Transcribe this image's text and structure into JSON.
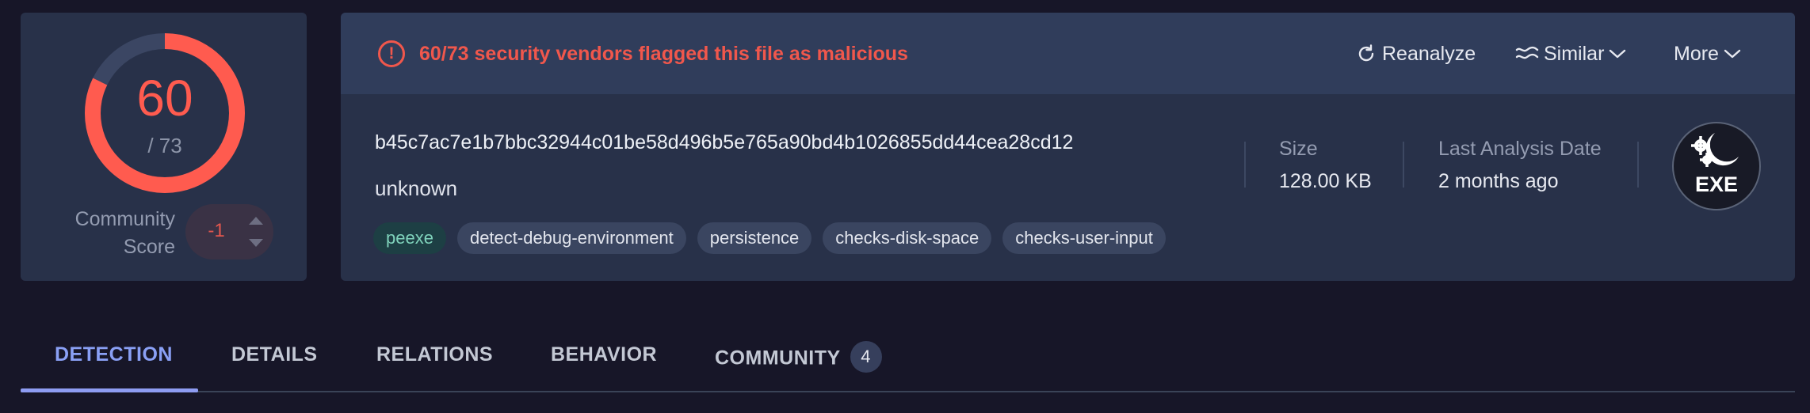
{
  "score": {
    "detections": "60",
    "total": "/ 73",
    "detection_ratio": 0.822,
    "community_label_line1": "Community",
    "community_label_line2": "Score",
    "community_value": "-1"
  },
  "alert": {
    "text": "60/73 security vendors flagged this file as malicious",
    "icon": "exclamation-circle-icon"
  },
  "actions": {
    "reanalyze": "Reanalyze",
    "similar": "Similar",
    "more": "More"
  },
  "file": {
    "hash": "b45c7ac7e1b7bbc32944c01be58d496b5e765a90bd4b1026855dd44cea28cd12",
    "type": "unknown",
    "tags": [
      "peexe",
      "detect-debug-environment",
      "persistence",
      "checks-disk-space",
      "checks-user-input"
    ],
    "size_label": "Size",
    "size_value": "128.00 KB",
    "date_label": "Last Analysis Date",
    "date_value": "2 months ago",
    "badge": "EXE"
  },
  "tabs": [
    {
      "label": "DETECTION"
    },
    {
      "label": "DETAILS"
    },
    {
      "label": "RELATIONS"
    },
    {
      "label": "BEHAVIOR"
    },
    {
      "label": "COMMUNITY",
      "count": "4"
    }
  ],
  "colors": {
    "background": "#171628",
    "card": "#283149",
    "alert_bar": "#303d5b",
    "danger": "#ff5b4f",
    "accent": "#8aa0f5",
    "tag_highlight": "#7fd2bb"
  }
}
